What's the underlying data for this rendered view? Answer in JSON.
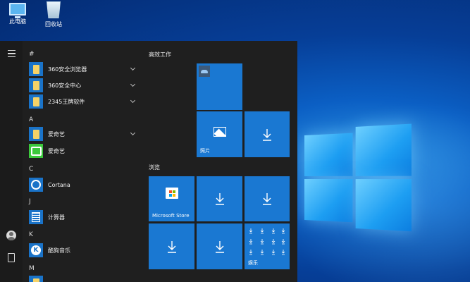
{
  "desktop": {
    "icons": [
      {
        "label": "此电脑",
        "icon": "computer-icon"
      },
      {
        "label": "回收站",
        "icon": "recycle-bin-icon"
      }
    ]
  },
  "start_menu": {
    "rail": {
      "menu_icon": "hamburger-icon",
      "user_icon": "user-avatar-icon",
      "docs_icon": "document-icon"
    },
    "app_list": {
      "sections": [
        {
          "letter": "#",
          "apps": [
            {
              "label": "360安全浏览器",
              "icon": "folder-icon",
              "expandable": true
            },
            {
              "label": "360安全中心",
              "icon": "folder-icon",
              "expandable": true
            },
            {
              "label": "2345王牌软件",
              "icon": "folder-icon",
              "expandable": true
            }
          ]
        },
        {
          "letter": "A",
          "apps": [
            {
              "label": "爱奇艺",
              "icon": "folder-icon",
              "expandable": true
            },
            {
              "label": "爱奇艺",
              "icon": "iqiyi-icon",
              "expandable": false
            }
          ]
        },
        {
          "letter": "C",
          "apps": [
            {
              "label": "Cortana",
              "icon": "cortana-icon",
              "expandable": false
            }
          ]
        },
        {
          "letter": "J",
          "apps": [
            {
              "label": "计算器",
              "icon": "calculator-icon",
              "expandable": false
            }
          ]
        },
        {
          "letter": "K",
          "apps": [
            {
              "label": "酷狗音乐",
              "icon": "kugou-icon",
              "icon_text": "K",
              "expandable": false
            }
          ]
        },
        {
          "letter": "M",
          "apps": []
        }
      ]
    },
    "tiles": {
      "groups": [
        {
          "title": "高效工作",
          "tiles": [
            {
              "label": "",
              "icon": "onedrive-icon"
            },
            {
              "label": "照片",
              "icon": "photos-icon"
            },
            {
              "label": "",
              "icon": "download-icon"
            }
          ]
        },
        {
          "title": "浏览",
          "tiles": [
            {
              "label": "Microsoft Store",
              "icon": "store-icon"
            },
            {
              "label": "",
              "icon": "download-icon"
            },
            {
              "label": "",
              "icon": "download-icon"
            },
            {
              "label": "",
              "icon": "download-icon"
            },
            {
              "label": "",
              "icon": "download-icon"
            },
            {
              "label": "娱乐",
              "icon": "download-group-icon"
            }
          ]
        }
      ]
    }
  },
  "colors": {
    "tile": "#1a78d2",
    "menu_bg": "#1f1f1f",
    "accent": "#1a73c8"
  }
}
